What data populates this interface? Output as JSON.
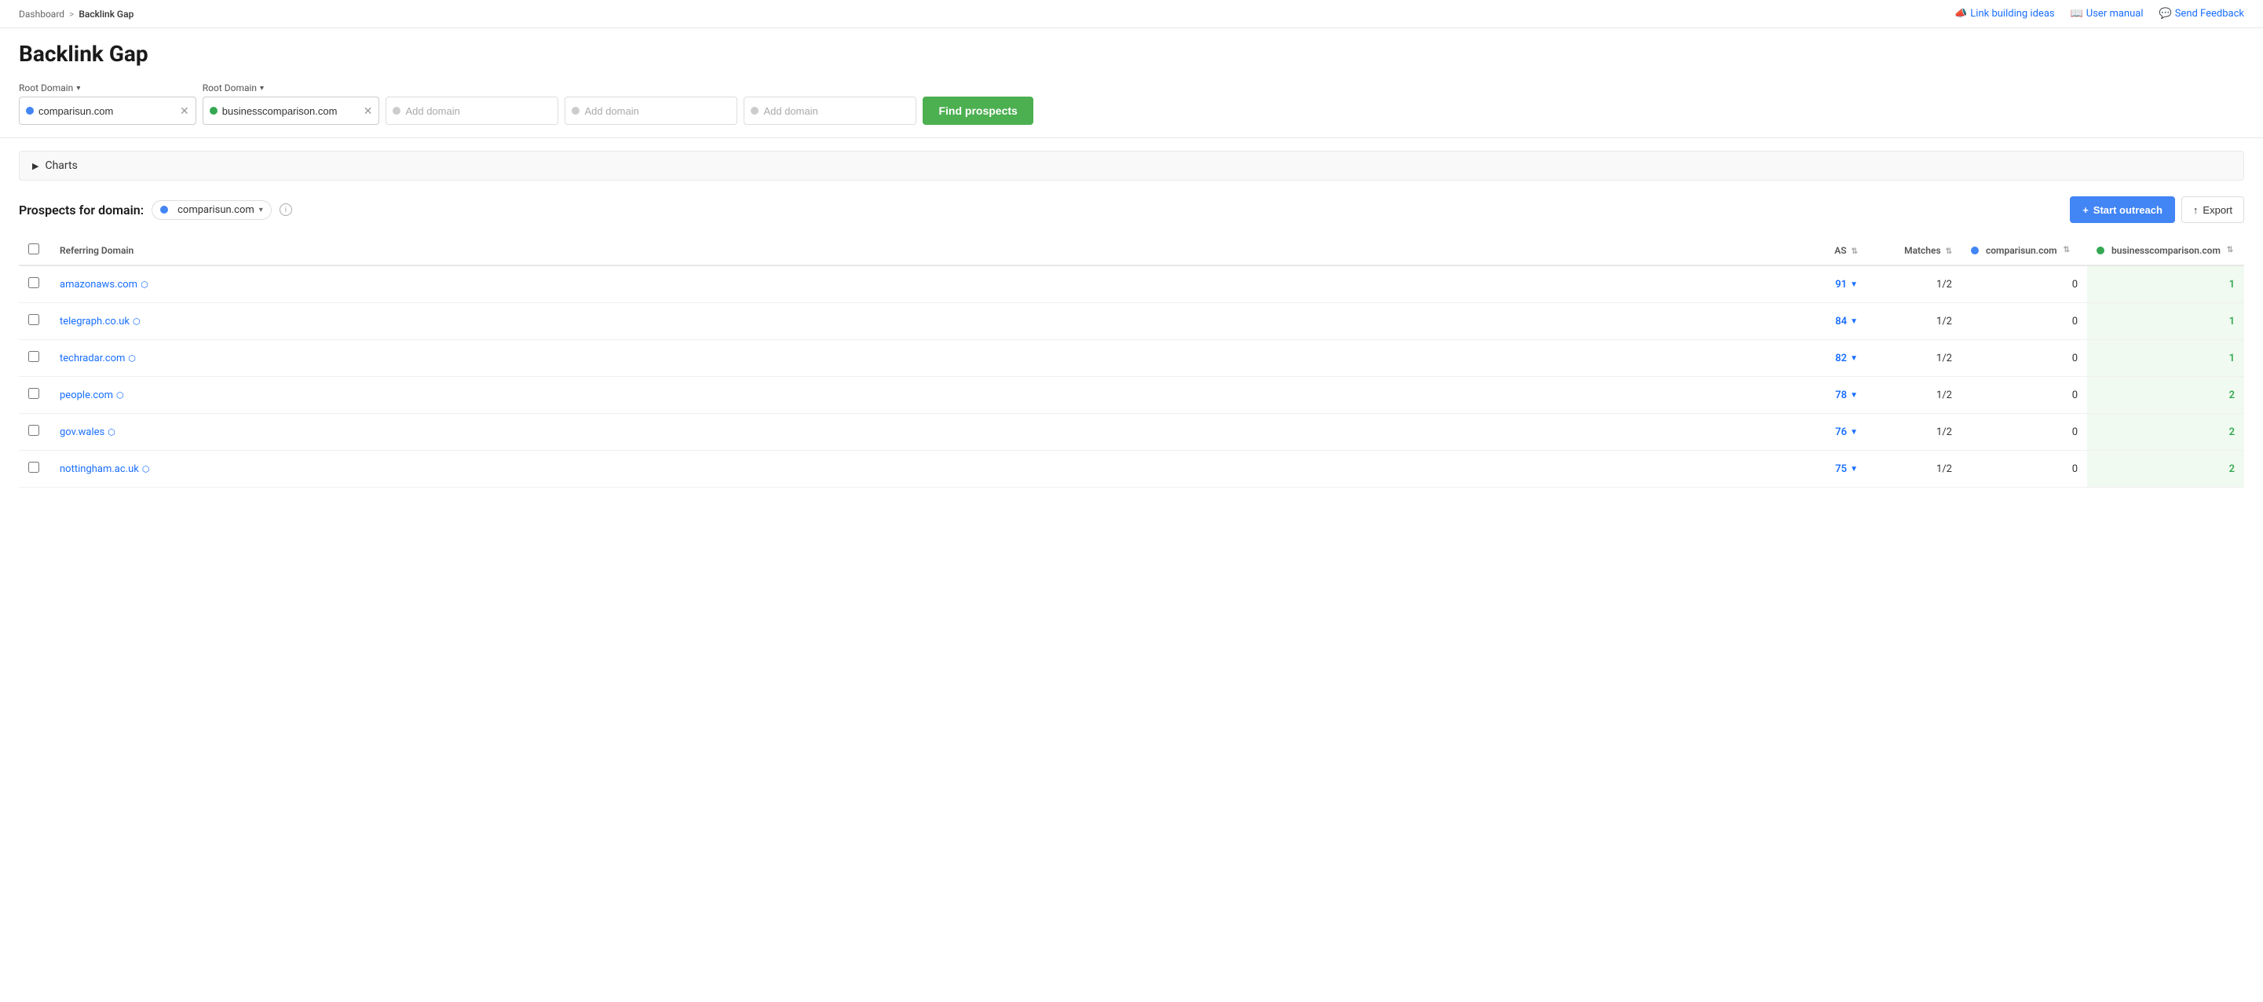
{
  "breadcrumb": {
    "parent": "Dashboard",
    "separator": ">",
    "current": "Backlink Gap"
  },
  "topNav": {
    "links": [
      {
        "id": "link-building",
        "label": "Link building ideas",
        "icon": "megaphone"
      },
      {
        "id": "user-manual",
        "label": "User manual",
        "icon": "book"
      },
      {
        "id": "send-feedback",
        "label": "Send Feedback",
        "icon": "chat"
      }
    ]
  },
  "page": {
    "title": "Backlink Gap"
  },
  "domainInputs": {
    "label1": "Root Domain",
    "label2": "Root Domain",
    "label3": "",
    "label4": "",
    "label5": "",
    "domain1": {
      "value": "comparisun.com",
      "dotColor": "blue"
    },
    "domain2": {
      "value": "businesscomparison.com",
      "dotColor": "green"
    },
    "placeholder3": "Add domain",
    "placeholder4": "Add domain",
    "placeholder5": "Add domain",
    "findProspectsLabel": "Find prospects"
  },
  "charts": {
    "toggleLabel": "Charts"
  },
  "prospects": {
    "label": "Prospects for domain:",
    "selectedDomain": "comparisun.com",
    "startOutreachLabel": "Start outreach",
    "exportLabel": "Export"
  },
  "table": {
    "columns": {
      "referringDomain": "Referring Domain",
      "as": "AS",
      "matches": "Matches",
      "comparisun": "comparisun.com",
      "businesscomparison": "businesscomparison.com"
    },
    "rows": [
      {
        "domain": "amazonaws.com",
        "as": 91,
        "matches": "1/2",
        "comparisun": 0,
        "businesscomparison": 1
      },
      {
        "domain": "telegraph.co.uk",
        "as": 84,
        "matches": "1/2",
        "comparisun": 0,
        "businesscomparison": 1
      },
      {
        "domain": "techradar.com",
        "as": 82,
        "matches": "1/2",
        "comparisun": 0,
        "businesscomparison": 1
      },
      {
        "domain": "people.com",
        "as": 78,
        "matches": "1/2",
        "comparisun": 0,
        "businesscomparison": 2
      },
      {
        "domain": "gov.wales",
        "as": 76,
        "matches": "1/2",
        "comparisun": 0,
        "businesscomparison": 2
      },
      {
        "domain": "nottingham.ac.uk",
        "as": 75,
        "matches": "1/2",
        "comparisun": 0,
        "businesscomparison": 2
      }
    ]
  }
}
